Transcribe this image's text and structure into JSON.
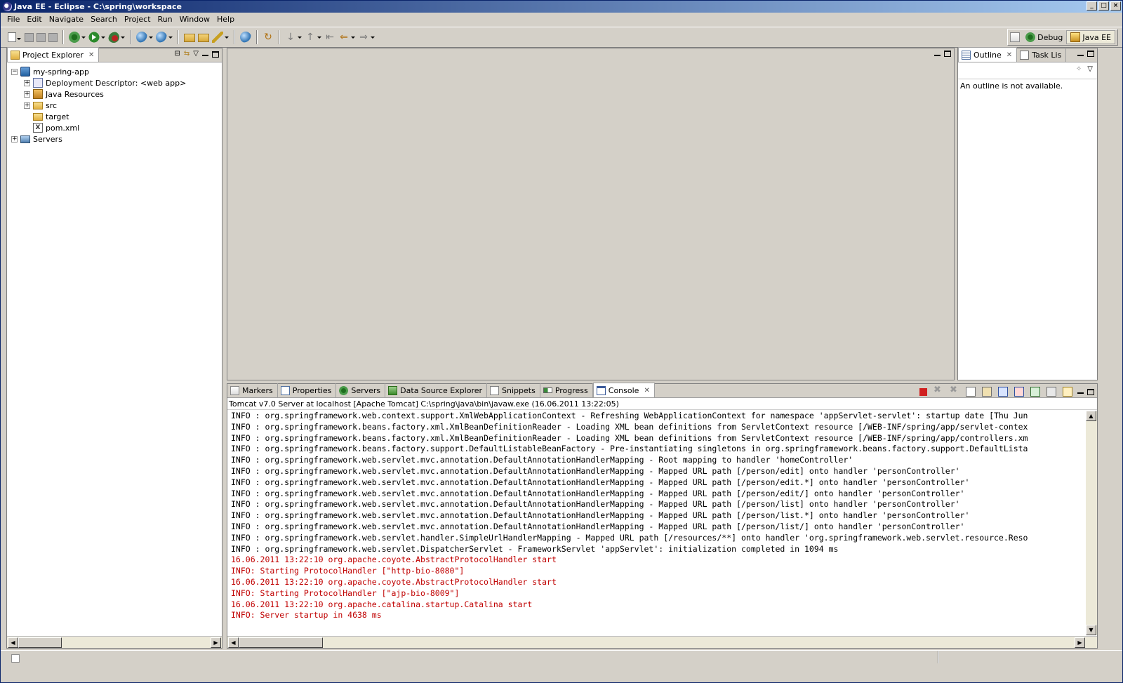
{
  "window": {
    "title": "Java EE - Eclipse - C:\\spring\\workspace",
    "controls": [
      "_",
      "□",
      "×"
    ]
  },
  "menu": [
    "File",
    "Edit",
    "Navigate",
    "Search",
    "Project",
    "Run",
    "Window",
    "Help"
  ],
  "perspectives": [
    {
      "label": "Debug",
      "active": false
    },
    {
      "label": "Java EE",
      "active": true
    }
  ],
  "project_explorer": {
    "tab_label": "Project Explorer",
    "tree": [
      {
        "label": "my-spring-app",
        "level": 0,
        "expander": "−",
        "icon": "project-icon"
      },
      {
        "label": "Deployment Descriptor: <web app>",
        "level": 1,
        "expander": "+",
        "icon": "deployment-descriptor-icon"
      },
      {
        "label": "Java Resources",
        "level": 1,
        "expander": "+",
        "icon": "java-resources-icon"
      },
      {
        "label": "src",
        "level": 1,
        "expander": "+",
        "icon": "folder-icon"
      },
      {
        "label": "target",
        "level": 1,
        "expander": "",
        "icon": "folder-icon"
      },
      {
        "label": "pom.xml",
        "level": 1,
        "expander": "",
        "icon": "xml-file-icon"
      },
      {
        "label": "Servers",
        "level": 0,
        "expander": "+",
        "icon": "servers-folder-icon"
      }
    ]
  },
  "outline": {
    "tabs": [
      "Outline",
      "Task Lis"
    ],
    "message": "An outline is not available."
  },
  "console": {
    "tabs": [
      "Markers",
      "Properties",
      "Servers",
      "Data Source Explorer",
      "Snippets",
      "Progress",
      "Console"
    ],
    "active_tab": "Console",
    "header": "Tomcat v7.0 Server at localhost [Apache Tomcat] C:\\spring\\java\\bin\\javaw.exe (16.06.2011 13:22:05)",
    "lines": [
      {
        "text": "INFO : org.springframework.web.context.support.XmlWebApplicationContext - Refreshing WebApplicationContext for namespace 'appServlet-servlet': startup date [Thu Jun",
        "err": false
      },
      {
        "text": "INFO : org.springframework.beans.factory.xml.XmlBeanDefinitionReader - Loading XML bean definitions from ServletContext resource [/WEB-INF/spring/app/servlet-contex",
        "err": false
      },
      {
        "text": "INFO : org.springframework.beans.factory.xml.XmlBeanDefinitionReader - Loading XML bean definitions from ServletContext resource [/WEB-INF/spring/app/controllers.xm",
        "err": false
      },
      {
        "text": "INFO : org.springframework.beans.factory.support.DefaultListableBeanFactory - Pre-instantiating singletons in org.springframework.beans.factory.support.DefaultLista",
        "err": false
      },
      {
        "text": "INFO : org.springframework.web.servlet.mvc.annotation.DefaultAnnotationHandlerMapping - Root mapping to handler 'homeController'",
        "err": false
      },
      {
        "text": "INFO : org.springframework.web.servlet.mvc.annotation.DefaultAnnotationHandlerMapping - Mapped URL path [/person/edit] onto handler 'personController'",
        "err": false
      },
      {
        "text": "INFO : org.springframework.web.servlet.mvc.annotation.DefaultAnnotationHandlerMapping - Mapped URL path [/person/edit.*] onto handler 'personController'",
        "err": false
      },
      {
        "text": "INFO : org.springframework.web.servlet.mvc.annotation.DefaultAnnotationHandlerMapping - Mapped URL path [/person/edit/] onto handler 'personController'",
        "err": false
      },
      {
        "text": "INFO : org.springframework.web.servlet.mvc.annotation.DefaultAnnotationHandlerMapping - Mapped URL path [/person/list] onto handler 'personController'",
        "err": false
      },
      {
        "text": "INFO : org.springframework.web.servlet.mvc.annotation.DefaultAnnotationHandlerMapping - Mapped URL path [/person/list.*] onto handler 'personController'",
        "err": false
      },
      {
        "text": "INFO : org.springframework.web.servlet.mvc.annotation.DefaultAnnotationHandlerMapping - Mapped URL path [/person/list/] onto handler 'personController'",
        "err": false
      },
      {
        "text": "INFO : org.springframework.web.servlet.handler.SimpleUrlHandlerMapping - Mapped URL path [/resources/**] onto handler 'org.springframework.web.servlet.resource.Reso",
        "err": false
      },
      {
        "text": "INFO : org.springframework.web.servlet.DispatcherServlet - FrameworkServlet 'appServlet': initialization completed in 1094 ms",
        "err": false
      },
      {
        "text": "16.06.2011 13:22:10 org.apache.coyote.AbstractProtocolHandler start",
        "err": true
      },
      {
        "text": "INFO: Starting ProtocolHandler [\"http-bio-8080\"]",
        "err": true
      },
      {
        "text": "16.06.2011 13:22:10 org.apache.coyote.AbstractProtocolHandler start",
        "err": true
      },
      {
        "text": "INFO: Starting ProtocolHandler [\"ajp-bio-8009\"]",
        "err": true
      },
      {
        "text": "16.06.2011 13:22:10 org.apache.catalina.startup.Catalina start",
        "err": true
      },
      {
        "text": "INFO: Server startup in 4638 ms",
        "err": true
      }
    ]
  },
  "colors": {
    "title_gradient_start": "#0a246a",
    "title_gradient_end": "#a6caf0",
    "stderr": "#c00000",
    "chrome": "#d4d0c8"
  }
}
